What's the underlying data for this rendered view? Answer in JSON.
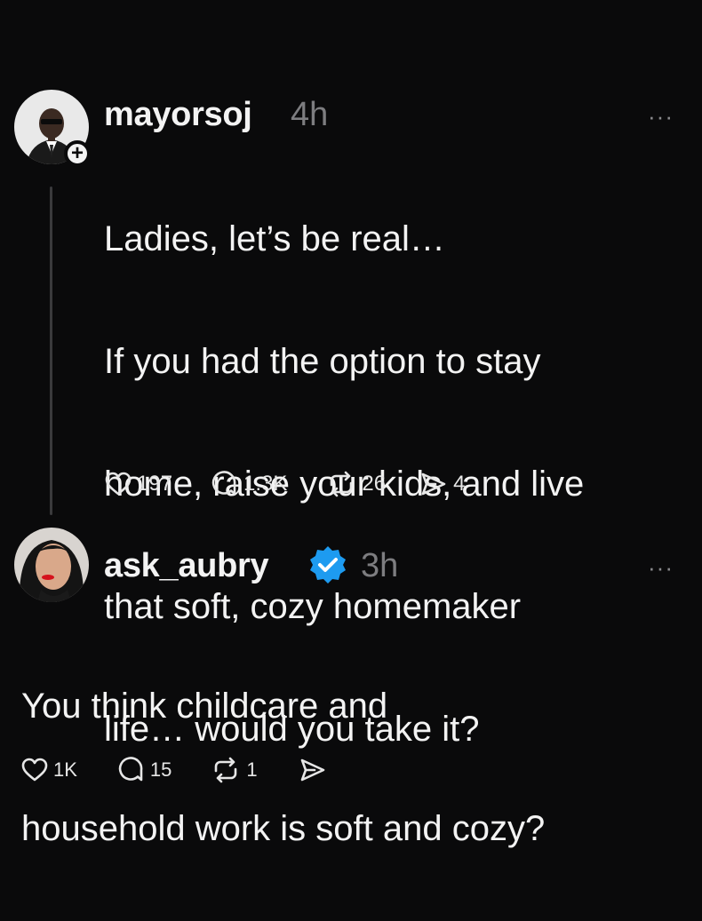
{
  "post1": {
    "username": "mayorsoj",
    "time": "4h",
    "more_icon": "more-icon",
    "text": "Ladies, let’s be real…\nIf you had the option to stay home, raise your kids, and live that soft, cozy homemaker life… would you take it?",
    "lines": [
      "Ladies, let’s be real…",
      "If you had the option to stay",
      "home, raise your kids, and live",
      "that soft, cozy homemaker",
      "life… would you take it?"
    ],
    "likes": "197",
    "replies": "1.3K",
    "reposts": "26",
    "shares": "4"
  },
  "post2": {
    "username": "ask_aubry",
    "time": "3h",
    "verified": true,
    "lines": [
      "You think childcare and",
      "household work is soft and cozy?"
    ],
    "likes": "1K",
    "replies": "15",
    "reposts": "1",
    "shares": ""
  },
  "colors": {
    "background": "#0a0a0b",
    "text": "#f3f3f3",
    "muted": "#7d7d80",
    "verified": "#1d9bf0"
  }
}
